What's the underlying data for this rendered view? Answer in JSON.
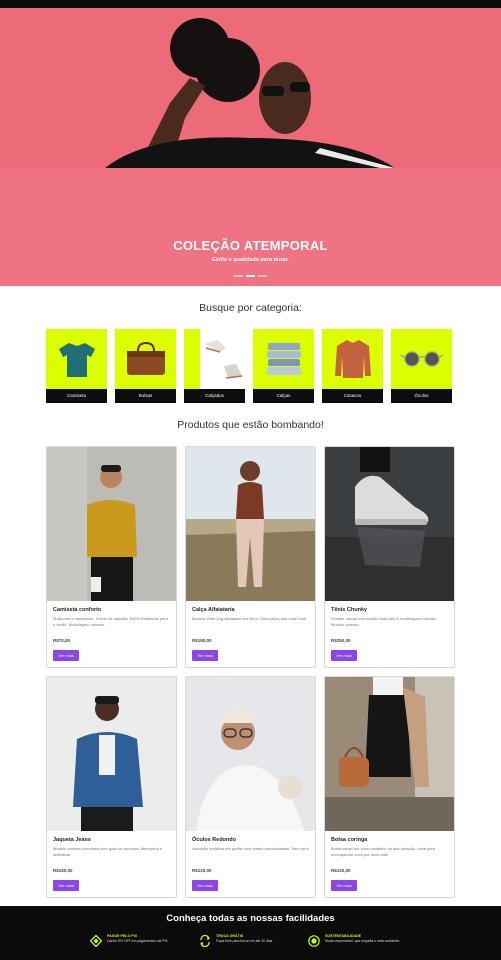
{
  "hero": {
    "title": "COLEÇÃO ATEMPORAL",
    "subtitle": "Estilo e qualidade para durar."
  },
  "categories_section": {
    "title": "Busque por categoria:",
    "items": [
      {
        "label": "Camiseta",
        "icon": "tshirt-icon"
      },
      {
        "label": "Bolsas",
        "icon": "bag-icon"
      },
      {
        "label": "Calçados",
        "icon": "shoes-icon"
      },
      {
        "label": "Calças",
        "icon": "pants-icon"
      },
      {
        "label": "Casacos",
        "icon": "coat-icon"
      },
      {
        "label": "Óculos",
        "icon": "glasses-icon"
      }
    ]
  },
  "products_section": {
    "title": "Produtos que estão bombando!",
    "button_label": "Ver mais",
    "products": [
      {
        "name": "Camiseta conforto",
        "description": "Multicores e tamanhos. Tecido de algodão 100% fortalecido para o verão. Modelagem unissex.",
        "price": "R$70,00"
      },
      {
        "name": "Calça Alfaiataria",
        "description": "Modelo Wide Leg alfaiataria em linho. Uma peça para toda hora!",
        "price": "R$180,00"
      },
      {
        "name": "Tênis Chunky",
        "description": "Snicker casual com solado mais alto e modelagem robusta. Modelo unissex.",
        "price": "R$250,00"
      },
      {
        "name": "Jaqueta Jeans",
        "description": "Modelo unissex oversized com gola de camurça. Atemporal e autêntica!",
        "price": "R$150,00"
      },
      {
        "name": "Óculos Redondo",
        "description": "Armação metálica em grafite com lentes arredondadas. Sem erro!",
        "price": "R$120,00"
      },
      {
        "name": "Bolsa coringa",
        "description": "Bolsa camel em couro sintético de alta duração. Ideal para acompanhar você por uma vida!",
        "price": "R$120,00"
      }
    ]
  },
  "footer": {
    "title": "Conheça todas as nossas facilidades",
    "features": [
      {
        "title": "PAGUE PELO PIX",
        "description": "Ganhe 5% OFF em pagamentos via PIX",
        "icon": "pix-icon"
      },
      {
        "title": "TROCA GRÁTIS",
        "description": "Fique livre para trocar em até 30 dias.",
        "icon": "exchange-icon"
      },
      {
        "title": "SUSTENTABILIDADE",
        "description": "Moda responsável, que respeita o meio ambiente.",
        "icon": "leaf-icon"
      }
    ]
  },
  "colors": {
    "accent": "#dcff00",
    "button": "#8a46e8",
    "hero": "#ef7382",
    "footer": "#0b0b0b",
    "footer_accent": "#c6ff00"
  }
}
